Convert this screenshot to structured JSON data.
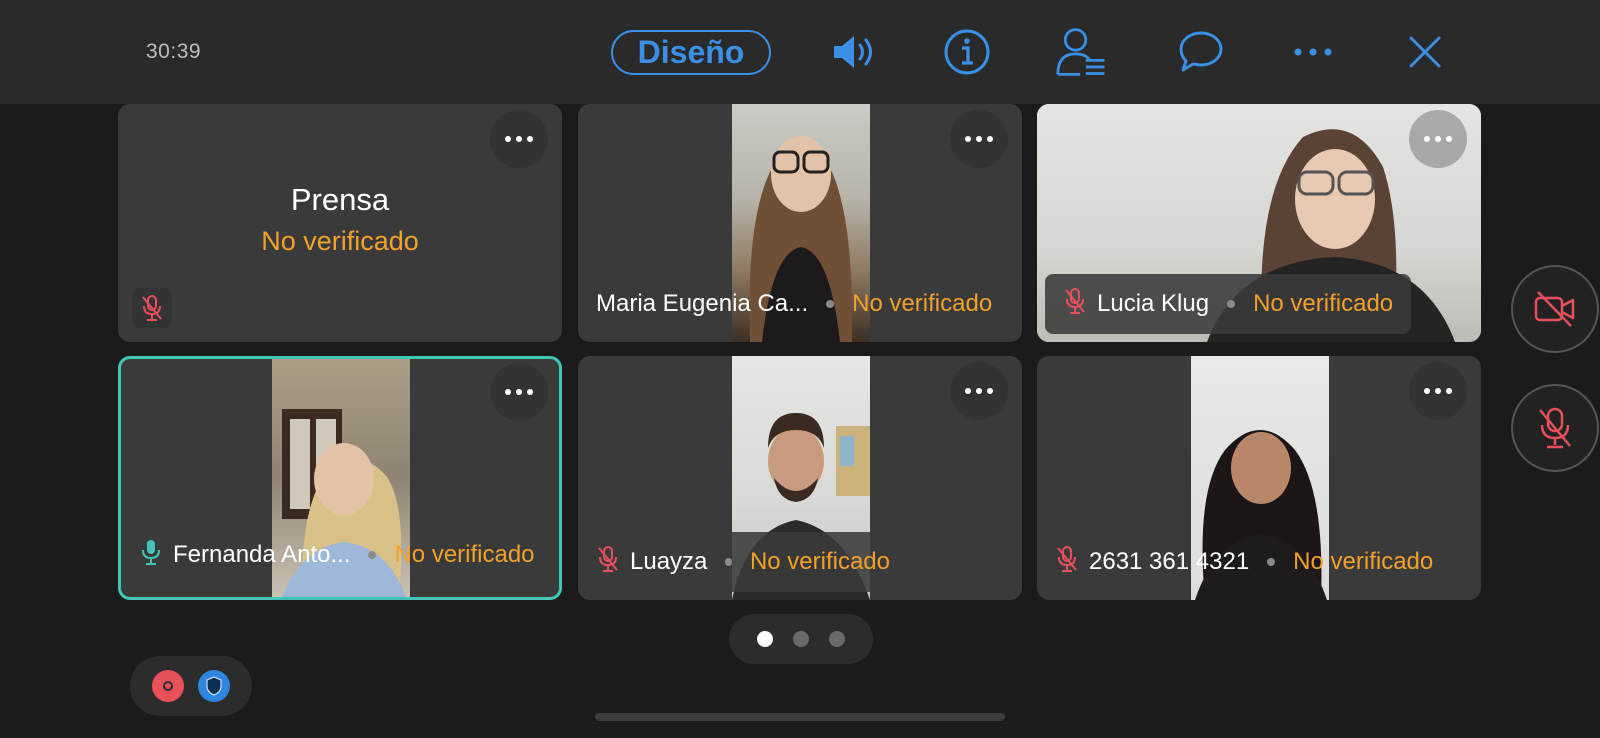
{
  "top_bar": {
    "time": "30:39",
    "layout_label": "Diseño",
    "icons": [
      "speaker-icon",
      "info-icon",
      "participants-icon",
      "chat-icon",
      "more-icon",
      "close-icon"
    ]
  },
  "tiles": [
    {
      "name": "Prensa",
      "status": "No verificado",
      "mic": "muted",
      "video": false
    },
    {
      "name": "Maria Eugenia Ca...",
      "status": "No verificado",
      "mic": "none",
      "video": true
    },
    {
      "name": "Lucia Klug",
      "status": "No verificado",
      "mic": "muted",
      "video": true
    },
    {
      "name": "Fernanda Anto...",
      "status": "No verificado",
      "mic": "active",
      "video": true,
      "active_speaker": true
    },
    {
      "name": "Luayza",
      "status": "No verificado",
      "mic": "muted",
      "video": true
    },
    {
      "name": "2631 361 4321",
      "status": "No verificado",
      "mic": "muted",
      "video": true
    }
  ],
  "pager": {
    "pages": 3,
    "current": 1
  },
  "colors": {
    "accent": "#3a8fe6",
    "status": "#f2a12b",
    "muted": "#e8505b",
    "active_border": "#3fc6b8"
  }
}
